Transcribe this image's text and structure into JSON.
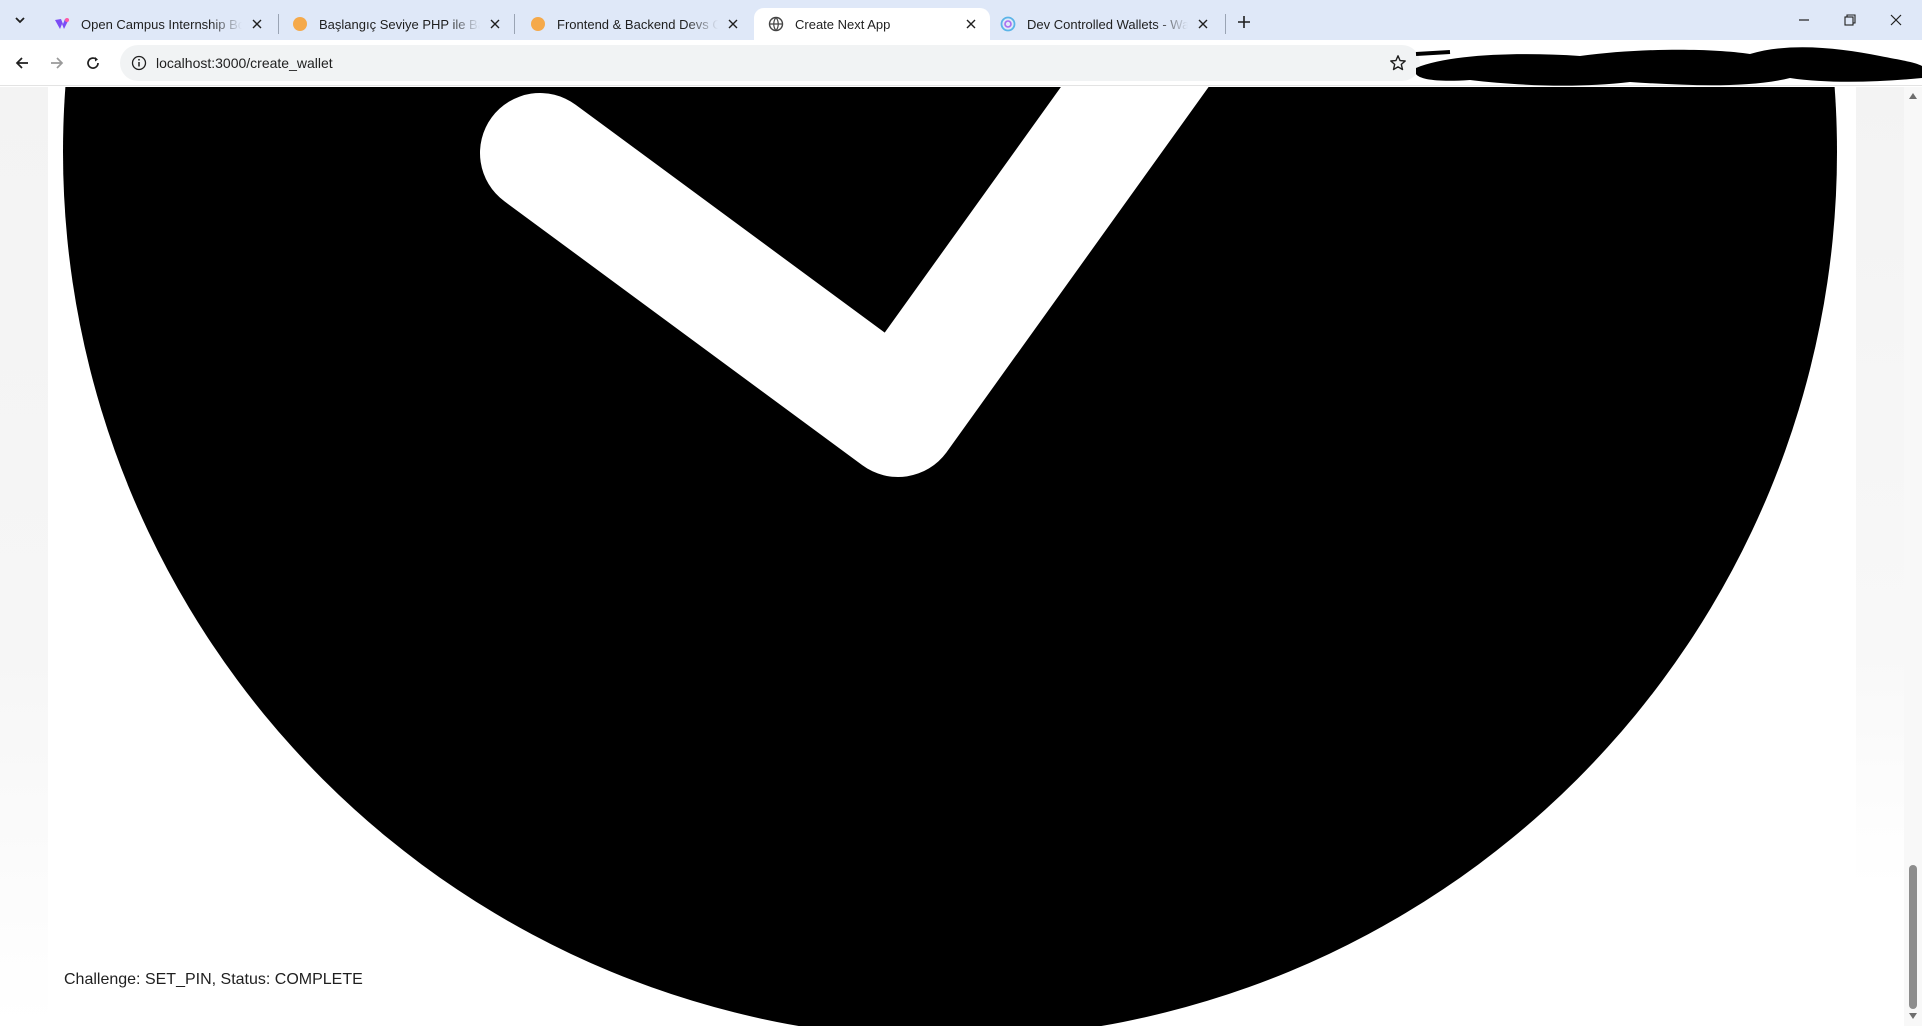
{
  "browser": {
    "tabs": [
      {
        "title": "Open Campus Internship Bootc",
        "icon": "open-campus-favicon",
        "active": false
      },
      {
        "title": "Başlangıç Seviye PHP ile Backen",
        "icon": "orange-circle-favicon",
        "active": false
      },
      {
        "title": "Frontend & Backend Devs Chall",
        "icon": "orange-circle-favicon",
        "active": false
      },
      {
        "title": "Create Next App",
        "icon": "globe-icon",
        "active": true
      },
      {
        "title": "Dev Controlled Wallets - Wallet",
        "icon": "circle-logo-favicon",
        "active": false
      }
    ],
    "url": "localhost:3000/create_wallet"
  },
  "page": {
    "status_text": "Challenge: SET_PIN, Status: COMPLETE"
  },
  "colors": {
    "tabstrip_bg": "#dfe8f8",
    "omnibox_bg": "#f1f3f4",
    "graphic": "#000000",
    "orange_favicon": "#f5a94a"
  }
}
